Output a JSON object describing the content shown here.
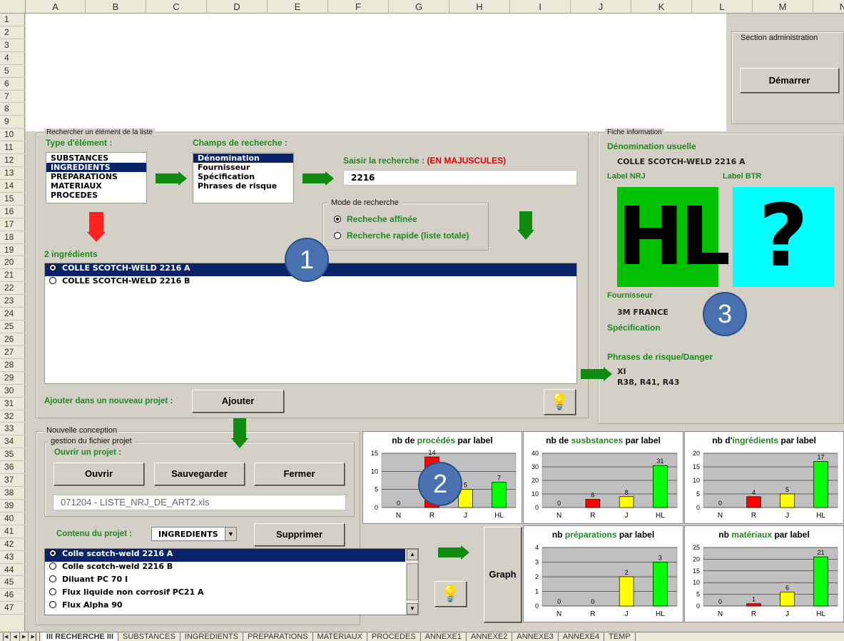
{
  "columns": [
    "A",
    "B",
    "C",
    "D",
    "E",
    "F",
    "G",
    "H",
    "I",
    "J",
    "K",
    "L",
    "M",
    "N"
  ],
  "rows": [
    "1",
    "2",
    "3",
    "4",
    "5",
    "6",
    "7",
    "8",
    "9",
    "10",
    "11",
    "12",
    "13",
    "14",
    "15",
    "16",
    "17",
    "18",
    "19",
    "20",
    "21",
    "22",
    "23",
    "24",
    "25",
    "26",
    "27",
    "28",
    "29",
    "30",
    "31",
    "32",
    "33",
    "34",
    "35",
    "36",
    "37",
    "38",
    "39",
    "40",
    "41",
    "42",
    "43",
    "44",
    "45",
    "46",
    "47"
  ],
  "admin": {
    "title": "Section administration",
    "start_button": "Démarrer"
  },
  "search": {
    "frame_title": "Rechercher un élément de la liste",
    "type_label": "Type d'élément :",
    "types": [
      "SUBSTANCES",
      "INGREDIENTS",
      "PREPARATIONS",
      "MATERIAUX",
      "PROCEDES"
    ],
    "fields_label": "Champs de recherche :",
    "fields": [
      "Dénomination",
      "Fournisseur",
      "Spécification",
      "Phrases de risque"
    ],
    "input_label": "Saisir la recherche :",
    "input_hint": "(EN MAJUSCULES)",
    "input_value": "2216",
    "mode_title": "Mode de recherche",
    "mode_options": [
      "Recheche affinée",
      "Recherche rapide (liste totale)"
    ],
    "results_label": "2 ingrédients",
    "results": [
      "COLLE SCOTCH-WELD 2216 A",
      "COLLE SCOTCH-WELD 2216 B"
    ],
    "add_label": "Ajouter dans un nouveau projet :",
    "add_button": "Ajouter"
  },
  "fiche": {
    "frame_title": "Fiche information",
    "denom_label": "Dénomination usuelle",
    "denom_value": "COLLE SCOTCH-WELD 2216 A",
    "nrj_label": "Label NRJ",
    "btr_label": "Label BTR",
    "nrj_value": "HL",
    "btr_value": "?",
    "nrj_color": "#00c000",
    "btr_color": "#00ffff",
    "supplier_label": "Fournisseur",
    "supplier_value": "3M FRANCE",
    "spec_label": "Spécification",
    "risk_label": "Phrases de risque/Danger",
    "risk_line1": "XI",
    "risk_line2": "R38, R41, R43"
  },
  "conception": {
    "frame_title": "Nouvelle conception",
    "file_title": "gestion du fichier projet",
    "open_label": "Ouvrir un projet :",
    "buttons": {
      "open": "Ouvrir",
      "save": "Sauvegarder",
      "close": "Fermer"
    },
    "file_value": "071204 - LISTE_NRJ_DE_ART2.xls",
    "content_label": "Contenu du projet :",
    "content_select": "INGREDIENTS",
    "delete_button": "Supprimer",
    "graph_button": "Graph",
    "items": [
      "Colle scotch-weld 2216 A",
      "Colle scotch-weld 2216 B",
      "Diluant PC 70 I",
      "Flux liquide non corrosif PC21 A",
      "Flux Alpha 90"
    ]
  },
  "callouts": [
    "1",
    "2",
    "3"
  ],
  "sheet_tabs": [
    "III RECHERCHE III",
    "SUBSTANCES",
    "INGREDIENTS",
    "PREPARATIONS",
    "MATERIAUX",
    "PROCEDES",
    "ANNEXE1",
    "ANNEXE2",
    "ANNEXE3",
    "ANNEXE4",
    "TEMP"
  ],
  "chart_data": [
    {
      "type": "bar",
      "title_pre": "nb de ",
      "title_key": "procédés",
      "title_post": " par label",
      "categories": [
        "N",
        "R",
        "J",
        "HL"
      ],
      "values": [
        0,
        14,
        5,
        7
      ],
      "ylim": [
        0,
        15
      ],
      "yticks": [
        0,
        5,
        10,
        15
      ],
      "colors": [
        "#00ff00",
        "#ff0000",
        "#ffff00",
        "#00ff00"
      ]
    },
    {
      "type": "bar",
      "title_pre": "nb de ",
      "title_key": "susbstances",
      "title_post": " par label",
      "categories": [
        "N",
        "R",
        "J",
        "HL"
      ],
      "values": [
        0,
        6,
        8,
        31
      ],
      "ylim": [
        0,
        40
      ],
      "yticks": [
        0,
        10,
        20,
        30,
        40
      ],
      "colors": [
        "#00ff00",
        "#ff0000",
        "#ffff00",
        "#00ff00"
      ]
    },
    {
      "type": "bar",
      "title_pre": "nb d'",
      "title_key": "ingrédients",
      "title_post": " par label",
      "categories": [
        "N",
        "R",
        "J",
        "HL"
      ],
      "values": [
        0,
        4,
        5,
        17
      ],
      "ylim": [
        0,
        20
      ],
      "yticks": [
        0,
        5,
        10,
        15,
        20
      ],
      "colors": [
        "#00ff00",
        "#ff0000",
        "#ffff00",
        "#00ff00"
      ]
    },
    {
      "type": "bar",
      "title_pre": "nb ",
      "title_key": "préparations",
      "title_post": " par label",
      "categories": [
        "N",
        "R",
        "J",
        "HL"
      ],
      "values": [
        0,
        0,
        2,
        3
      ],
      "ylim": [
        0,
        4
      ],
      "yticks": [
        0,
        1,
        2,
        3,
        4
      ],
      "colors": [
        "#00ff00",
        "#ff0000",
        "#ffff00",
        "#00ff00"
      ]
    },
    {
      "type": "bar",
      "title_pre": "nb ",
      "title_key": "matériaux",
      "title_post": " par label",
      "categories": [
        "N",
        "R",
        "J",
        "HL"
      ],
      "values": [
        0,
        1,
        6,
        21
      ],
      "ylim": [
        0,
        25
      ],
      "yticks": [
        0,
        5,
        10,
        15,
        20,
        25
      ],
      "colors": [
        "#00ff00",
        "#ff0000",
        "#ffff00",
        "#00ff00"
      ]
    }
  ]
}
